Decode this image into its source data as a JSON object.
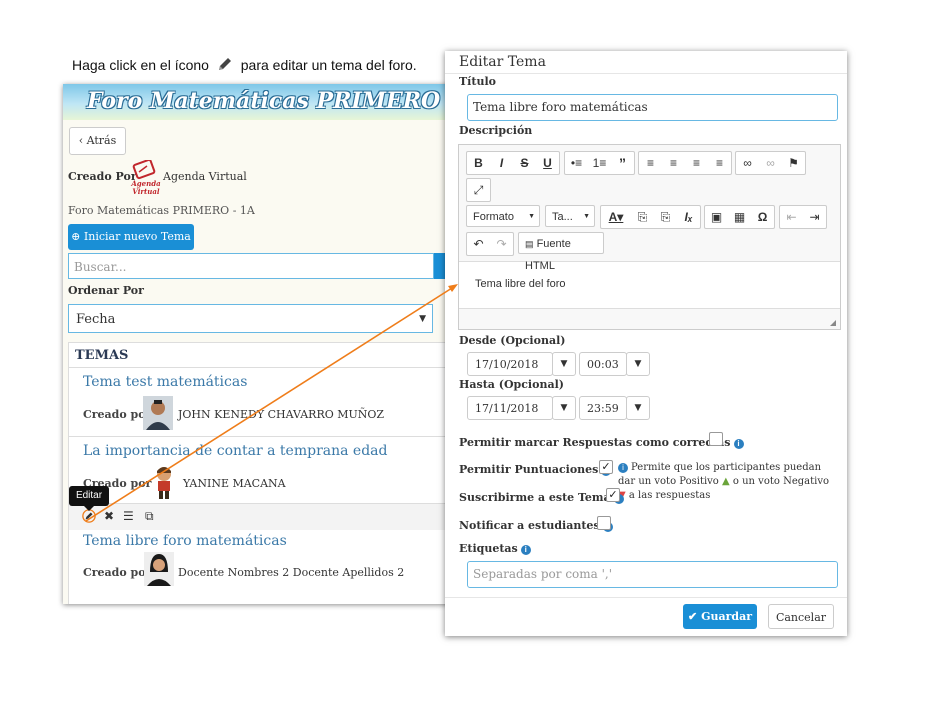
{
  "instruction": {
    "before": "Haga click en el ícono",
    "after": "para editar un tema del foro."
  },
  "forum": {
    "title": "Foro Matemáticas PRIMERO - 1A",
    "back_label": "Atrás",
    "created_by_label": "Creado Por",
    "logo_text": "Agenda Virtual",
    "creator": "Agenda Virtual",
    "breadcrumb": "Foro Matemáticas PRIMERO - 1A",
    "new_topic_label": "Iniciar nuevo Tema",
    "search_placeholder": "Buscar...",
    "order_label": "Ordenar Por",
    "order_value": "Fecha",
    "topics_header": "TEMAS",
    "topics": [
      {
        "title": "Tema test matemáticas",
        "by": "Creado por",
        "author": "JOHN KENEDY CHAVARRO MUÑOZ"
      },
      {
        "title": "La importancia de contar a temprana edad",
        "by": "Creado por",
        "author": "YANINE MACANA"
      },
      {
        "title": "Tema libre foro matemáticas",
        "by": "Creado por",
        "author": "Docente Nombres 2 Docente Apellidos 2"
      }
    ],
    "tooltip": "Editar",
    "actions": [
      "edit-icon",
      "delete-icon",
      "list-icon",
      "copy-icon"
    ]
  },
  "modal": {
    "title": "Editar Tema",
    "title_label": "Título",
    "title_value": "Tema libre foro matemáticas",
    "description_label": "Descripción",
    "toolbar": {
      "format_label": "Formato",
      "size_label": "Ta...",
      "source_label": "Fuente HTML"
    },
    "description_value": "Tema libre del foro",
    "from_label": "Desde (Opcional)",
    "from_date": "17/10/2018",
    "from_time": "00:03",
    "to_label": "Hasta (Opcional)",
    "to_date": "17/11/2018",
    "to_time": "23:59",
    "allow_correct_label": "Permitir marcar Respuestas como correctas",
    "allow_correct_checked": false,
    "allow_scores_label": "Permitir Puntuaciones",
    "allow_scores_checked": true,
    "subscribe_label": "Suscribirme a este Tema",
    "subscribe_checked": true,
    "notify_label": "Notificar a estudiantes",
    "notify_checked": false,
    "help_part1": "Permite que los participantes puedan dar un voto Positivo",
    "help_part2": "o un voto Negativo",
    "help_part3": "a las respuestas",
    "tags_label": "Etiquetas",
    "tags_placeholder": "Separadas por coma ','",
    "save_label": "Guardar",
    "cancel_label": "Cancelar"
  },
  "colors": {
    "primary": "#1a8fd6",
    "arrow": "#ef7d1a",
    "title_link": "#3b79a8"
  }
}
